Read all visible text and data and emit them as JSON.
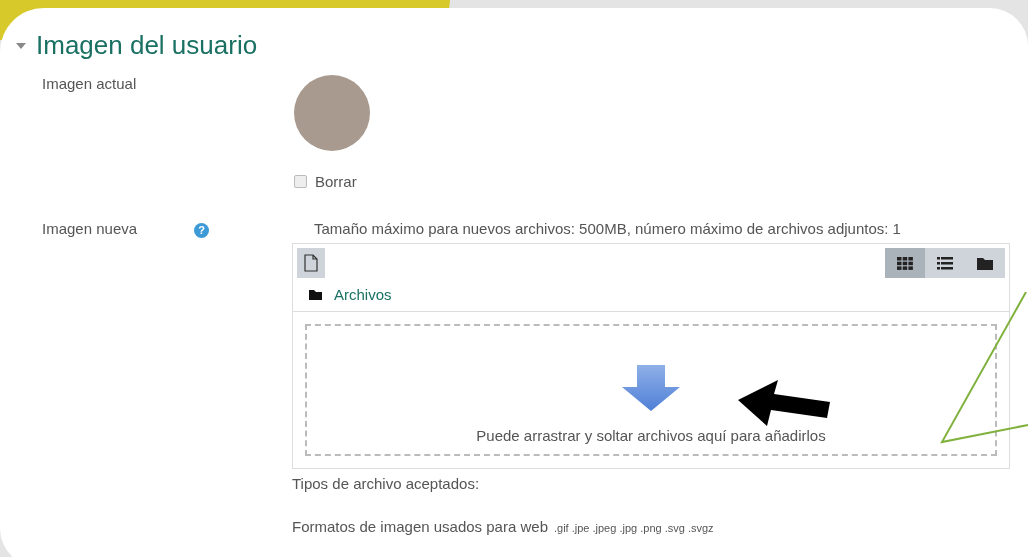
{
  "section": {
    "title": "Imagen del usuario",
    "expanded": true
  },
  "current_image": {
    "label": "Imagen actual",
    "delete_checkbox": {
      "label": "Borrar",
      "checked": false
    }
  },
  "new_image": {
    "label": "Imagen nueva",
    "help": "?",
    "limits": "Tamaño máximo para nuevos archivos: 500MB, número máximo de archivos adjuntos: 1",
    "view_buttons": [
      {
        "kind": "grid",
        "selected": true
      },
      {
        "kind": "list",
        "selected": false
      },
      {
        "kind": "tree",
        "selected": false
      }
    ],
    "folder": "Archivos",
    "drop_hint": "Puede arrastrar y soltar archivos aquí para añadirlos",
    "accepted_label": "Tipos de archivo aceptados:",
    "formats_label": "Formatos de imagen usados para web",
    "extensions": ".gif .jpe .jpeg .jpg .png .svg .svgz"
  }
}
